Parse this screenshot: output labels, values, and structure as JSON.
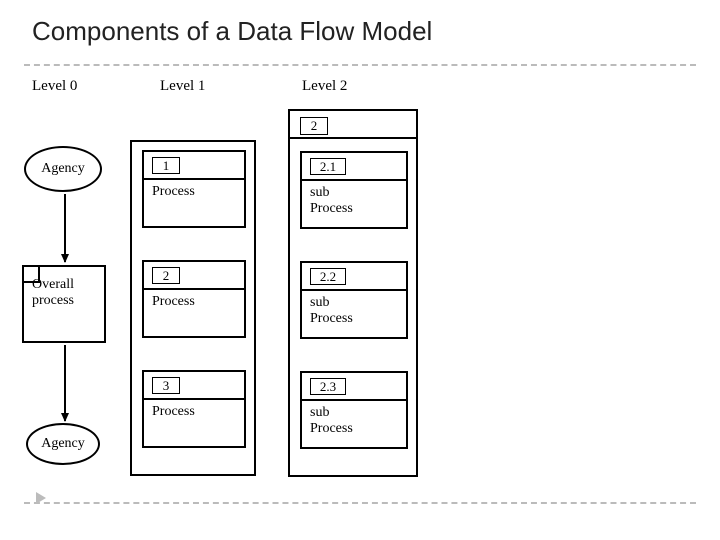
{
  "title": "Components of a Data Flow Model",
  "columns": {
    "level0": "Level 0",
    "level1": "Level 1",
    "level2": "Level 2"
  },
  "level0": {
    "agency_top": "Agency",
    "overall": "Overall\nprocess",
    "agency_bottom": "Agency"
  },
  "level1": {
    "processes": [
      {
        "num": "1",
        "label": "Process"
      },
      {
        "num": "2",
        "label": "Process"
      },
      {
        "num": "3",
        "label": "Process"
      }
    ]
  },
  "level2": {
    "header_num": "2",
    "subprocesses": [
      {
        "num": "2.1",
        "label": "sub\nProcess"
      },
      {
        "num": "2.2",
        "label": "sub\nProcess"
      },
      {
        "num": "2.3",
        "label": "sub\nProcess"
      }
    ]
  }
}
